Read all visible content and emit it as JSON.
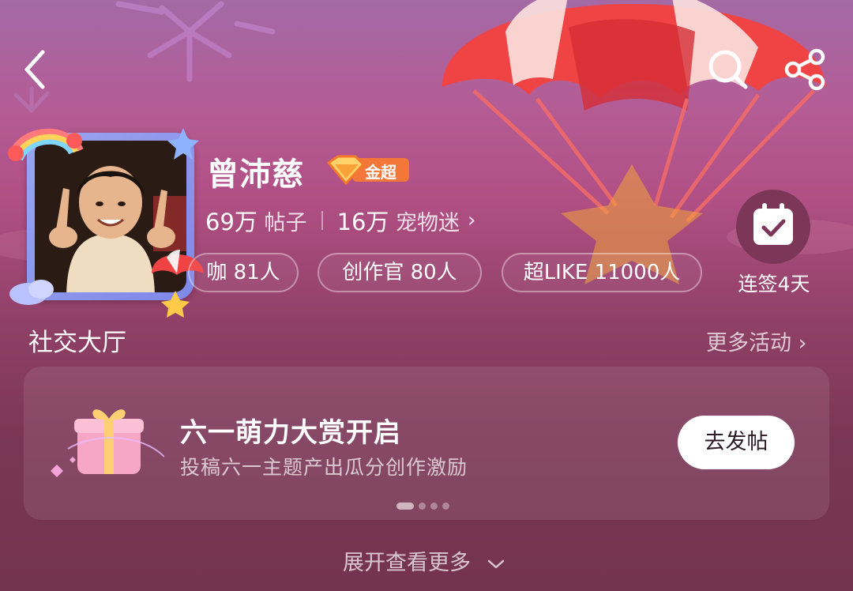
{
  "header": {
    "back_icon": "chevron-left-icon",
    "search_icon": "search-icon",
    "share_icon": "share-icon"
  },
  "profile": {
    "name": "曾沛慈",
    "badge_label": "金超",
    "badge_icon": "diamond-level-icon",
    "stats": {
      "posts_value": "69万",
      "posts_label": "帖子",
      "fans_value": "16万",
      "fans_label": "宠物迷"
    },
    "pills": [
      {
        "label": "咖 81人"
      },
      {
        "label": "创作官 80人"
      },
      {
        "label": "超LIKE 11000人"
      }
    ],
    "checkin_label": "连签4天"
  },
  "social_hall": {
    "title": "社交大厅",
    "more_label": "更多活动"
  },
  "activity_card": {
    "title": "六一萌力大赏开启",
    "subtitle": "投稿六一主题产出瓜分创作激励",
    "button_label": "去发帖",
    "pager_count": 4,
    "pager_active": 0
  },
  "footer": {
    "expand_label": "展开查看更多"
  },
  "colors": {
    "bg_top": "#a36aa6",
    "bg_bottom": "#74334f",
    "parachute_red": "#ef3f3f",
    "badge_orange": "#f4773a"
  }
}
